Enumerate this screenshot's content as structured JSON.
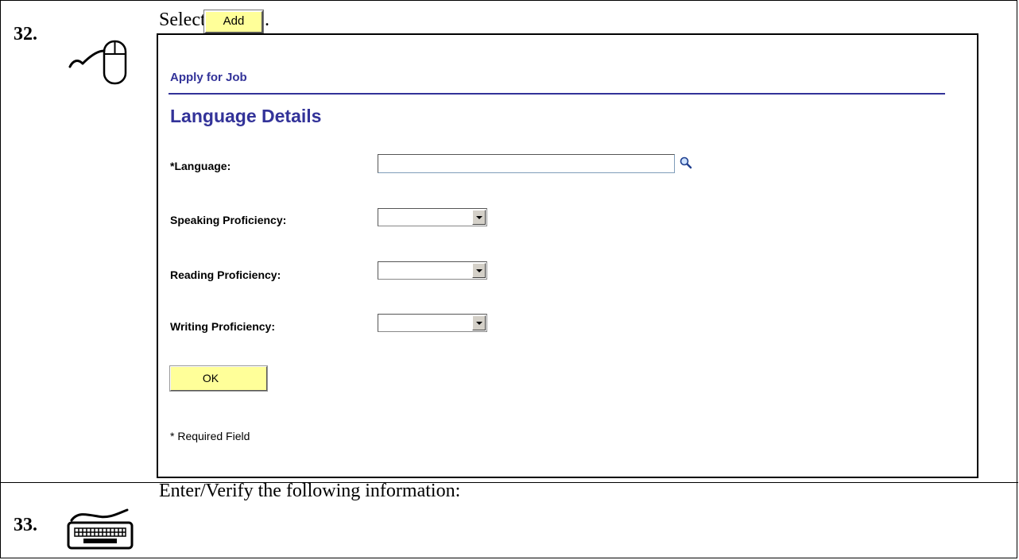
{
  "steps": [
    {
      "number": "32.",
      "icon": "mouse-icon",
      "instruction_prefix": "Select",
      "instruction_button": "Add",
      "instruction_suffix": "."
    },
    {
      "number": "33.",
      "icon": "keyboard-icon",
      "instruction": "Enter/Verify the following information:"
    }
  ],
  "screen": {
    "breadcrumb": "Apply for Job",
    "title": "Language Details",
    "fields": [
      {
        "label": "*Language:",
        "type": "text-lookup",
        "value": ""
      },
      {
        "label": "Speaking Proficiency:",
        "type": "select",
        "value": ""
      },
      {
        "label": "Reading Proficiency:",
        "type": "select",
        "value": ""
      },
      {
        "label": "Writing Proficiency:",
        "type": "select",
        "value": ""
      }
    ],
    "ok_label": "OK",
    "required_note": "* Required Field"
  },
  "colors": {
    "ps_heading": "#333399",
    "button_fill": "#ffff99"
  }
}
